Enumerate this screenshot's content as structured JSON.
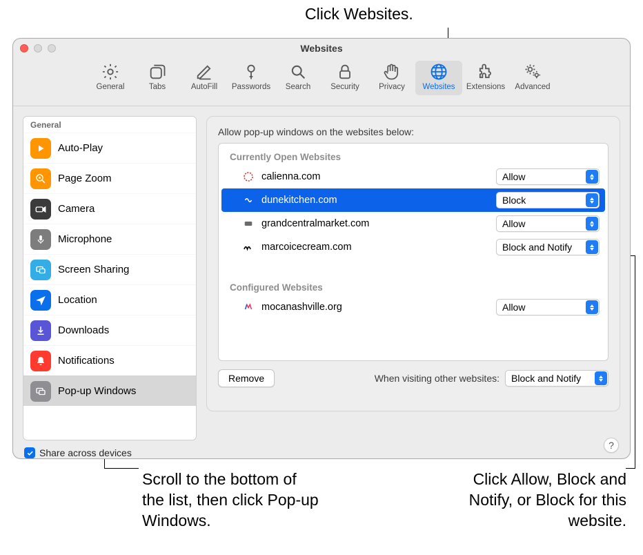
{
  "callouts": {
    "top": "Click Websites.",
    "bottomLeft": "Scroll to the bottom of the list, then click Pop-up Windows.",
    "bottomRight": "Click Allow, Block and Notify, or Block for this website."
  },
  "window": {
    "title": "Websites"
  },
  "toolbar": {
    "items": [
      {
        "id": "general",
        "label": "General"
      },
      {
        "id": "tabs",
        "label": "Tabs"
      },
      {
        "id": "autofill",
        "label": "AutoFill"
      },
      {
        "id": "passwords",
        "label": "Passwords"
      },
      {
        "id": "search",
        "label": "Search"
      },
      {
        "id": "security",
        "label": "Security"
      },
      {
        "id": "privacy",
        "label": "Privacy"
      },
      {
        "id": "websites",
        "label": "Websites",
        "selected": true
      },
      {
        "id": "extensions",
        "label": "Extensions"
      },
      {
        "id": "advanced",
        "label": "Advanced"
      }
    ]
  },
  "sidebar": {
    "heading": "General",
    "items": [
      {
        "label": "Auto-Play",
        "iconBg": "#ff9500",
        "iconName": "play-icon"
      },
      {
        "label": "Page Zoom",
        "iconBg": "#ff9500",
        "iconName": "zoom-icon"
      },
      {
        "label": "Camera",
        "iconBg": "#3b3b3b",
        "iconName": "camera-icon"
      },
      {
        "label": "Microphone",
        "iconBg": "#7d7d7d",
        "iconName": "microphone-icon"
      },
      {
        "label": "Screen Sharing",
        "iconBg": "#32ade6",
        "iconName": "screenshare-icon"
      },
      {
        "label": "Location",
        "iconBg": "#0a6fea",
        "iconName": "location-icon"
      },
      {
        "label": "Downloads",
        "iconBg": "#5856d6",
        "iconName": "download-icon"
      },
      {
        "label": "Notifications",
        "iconBg": "#ff3b30",
        "iconName": "bell-icon"
      },
      {
        "label": "Pop-up Windows",
        "iconBg": "#8e8e93",
        "iconName": "windows-icon",
        "selected": true
      }
    ],
    "share_label": "Share across devices",
    "share_checked": true
  },
  "main": {
    "title": "Allow pop-up windows on the websites below:",
    "group_open": "Currently Open Websites",
    "group_configured": "Configured Websites",
    "open_sites": [
      {
        "name": "calienna.com",
        "value": "Allow",
        "faviconColor": "#d43a3a"
      },
      {
        "name": "dunekitchen.com",
        "value": "Block",
        "faviconColor": "#ffffff",
        "selected": true
      },
      {
        "name": "grandcentralmarket.com",
        "value": "Allow",
        "faviconColor": "#6b6b6b"
      },
      {
        "name": "marcoicecream.com",
        "value": "Block and Notify",
        "faviconColor": "#000000"
      }
    ],
    "configured_sites": [
      {
        "name": "mocanashville.org",
        "value": "Allow",
        "faviconColor": "#ff2d55"
      }
    ],
    "remove_label": "Remove",
    "other_label": "When visiting other websites:",
    "other_value": "Block and Notify"
  }
}
